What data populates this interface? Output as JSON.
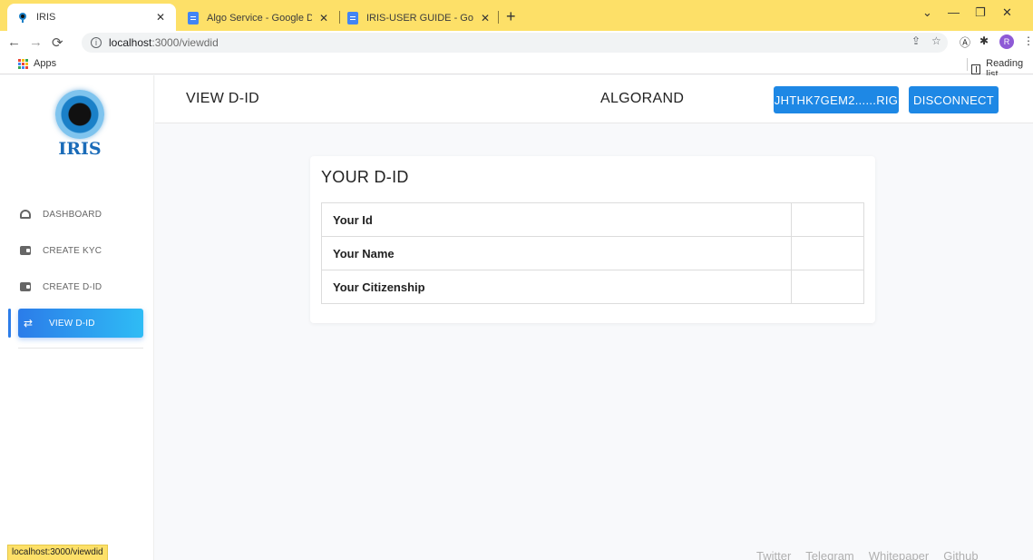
{
  "browser": {
    "tabs": [
      {
        "title": "IRIS",
        "favicon": "iris-eye-icon",
        "active": true
      },
      {
        "title": "Algo Service - Google Docs",
        "favicon": "google-docs-icon",
        "active": false
      },
      {
        "title": "IRIS-USER GUIDE - Google Docs",
        "favicon": "google-docs-icon",
        "active": false
      }
    ],
    "url_host": "localhost",
    "url_path": ":3000/viewdid",
    "bookmarks_apps_label": "Apps",
    "reading_list_label": "Reading list",
    "profile_initial": "R",
    "status_url": "localhost:3000/viewdid",
    "tab_color": "#fde068"
  },
  "sidebar": {
    "logo_text": "IRIS",
    "items": [
      {
        "label": "DASHBOARD",
        "icon": "gauge-icon"
      },
      {
        "label": "CREATE KYC",
        "icon": "wallet-icon"
      },
      {
        "label": "CREATE D-ID",
        "icon": "wallet-icon"
      },
      {
        "label": "VIEW D-ID",
        "icon": "swap-icon",
        "active": true
      }
    ]
  },
  "header": {
    "page_title": "VIEW D-ID",
    "network": "ALGORAND",
    "wallet_address": "JHTHK7GEM2......RIG",
    "disconnect_label": "DISCONNECT",
    "accent_color": "#1e88e5"
  },
  "main": {
    "card_title": "YOUR D-ID",
    "rows": [
      {
        "label": "Your Id",
        "value": ""
      },
      {
        "label": "Your Name",
        "value": ""
      },
      {
        "label": "Your Citizenship",
        "value": ""
      }
    ]
  },
  "footer": {
    "links": [
      "Twitter",
      "Telegram",
      "Whitepaper",
      "Github"
    ]
  }
}
